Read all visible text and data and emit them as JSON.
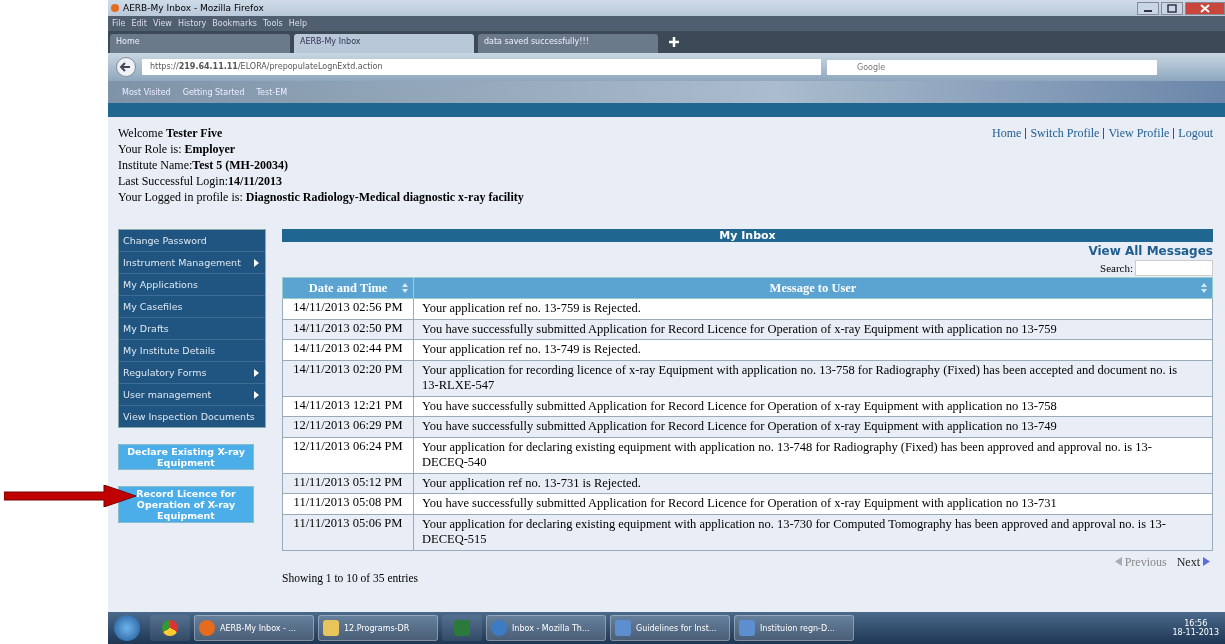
{
  "browser": {
    "title": "AERB-My Inbox - Mozilla Firefox",
    "menu": [
      "File",
      "Edit",
      "View",
      "History",
      "Bookmarks",
      "Tools",
      "Help"
    ],
    "tabs": [
      {
        "label": "Home",
        "selected": false
      },
      {
        "label": "AERB-My Inbox",
        "selected": true
      },
      {
        "label": "data saved successfully!!!",
        "selected": false
      }
    ],
    "url": "https://**219.64.11.11**/ELORA/prepopulateLognExtd.action",
    "search_placeholder": "Google",
    "bookmarks": [
      "Most Visited",
      "Getting Started",
      "Test-EM"
    ]
  },
  "header": {
    "lines": [
      "Welcome **Tester Five**",
      "Your Role is: **Employer**",
      "Institute Name:**Test 5 (MH-20034)**",
      "Last Successful Login:**14/11/2013**",
      "Your Logged in profile is: **Diagnostic Radiology-Medical diagnostic x-ray facility**"
    ],
    "links": [
      "Home",
      "Switch Profile",
      "View Profile",
      "Logout"
    ]
  },
  "sidebar": {
    "items": [
      {
        "label": "Change Password",
        "has_submenu": false
      },
      {
        "label": "Instrument Management",
        "has_submenu": true
      },
      {
        "label": "My Applications",
        "has_submenu": false
      },
      {
        "label": "My Casefiles",
        "has_submenu": false
      },
      {
        "label": "My Drafts",
        "has_submenu": false
      },
      {
        "label": "My Institute Details",
        "has_submenu": false
      },
      {
        "label": "Regulatory Forms",
        "has_submenu": true
      },
      {
        "label": "User management",
        "has_submenu": true
      },
      {
        "label": "View Inspection Documents",
        "has_submenu": false
      }
    ],
    "actions": [
      "Declare Existing X-ray Equipment",
      "Record Licence for Operation of X-ray Equipment"
    ]
  },
  "inbox": {
    "title": "My Inbox",
    "view_all": "View All Messages",
    "search_label": "Search:",
    "columns": [
      "Date and Time",
      "Message to User"
    ],
    "rows": [
      {
        "date": "14/11/2013 02:56 PM",
        "message": "Your application ref no. 13-759 is Rejected."
      },
      {
        "date": "14/11/2013 02:50 PM",
        "message": "You have successfully submitted Application for Record Licence for Operation of x-ray Equipment with application no 13-759"
      },
      {
        "date": "14/11/2013 02:44 PM",
        "message": "Your application ref no. 13-749 is Rejected."
      },
      {
        "date": "14/11/2013 02:20 PM",
        "message": "Your application for recording licence of x-ray Equipment with application no. 13-758 for Radiography (Fixed) has been accepted and document no. is 13-RLXE-547"
      },
      {
        "date": "14/11/2013 12:21 PM",
        "message": "You have successfully submitted Application for Record Licence for Operation of x-ray Equipment with application no 13-758"
      },
      {
        "date": "12/11/2013 06:29 PM",
        "message": "You have successfully submitted Application for Record Licence for Operation of x-ray Equipment with application no 13-749"
      },
      {
        "date": "12/11/2013 06:24 PM",
        "message": "Your application for declaring existing equipment with application no. 13-748 for Radiography (Fixed) has been approved and approval no. is 13-DECEQ-540"
      },
      {
        "date": "11/11/2013 05:12 PM",
        "message": "Your application ref no. 13-731 is Rejected."
      },
      {
        "date": "11/11/2013 05:08 PM",
        "message": "You have successfully submitted Application for Record Licence for Operation of x-ray Equipment with application no 13-731"
      },
      {
        "date": "11/11/2013 05:06 PM",
        "message": "Your application for declaring existing equipment with application no. 13-730 for Computed Tomography has been approved and approval no. is 13-DECEQ-515"
      }
    ],
    "showing": "Showing 1 to 10 of 35 entries",
    "previous": {
      "label": "Previous",
      "disabled": true
    },
    "next": {
      "label": "Next",
      "disabled": false
    }
  },
  "taskbar": {
    "items": [
      {
        "kind": "start"
      },
      {
        "kind": "chrome"
      },
      {
        "label": "AERB-My Inbox - ...",
        "kind": "firefox"
      },
      {
        "label": "12.Programs-DR",
        "kind": "folder"
      },
      {
        "kind": "excel"
      },
      {
        "label": "Inbox - Mozilla Th...",
        "kind": "mail"
      },
      {
        "label": "Guidelines for Inst...",
        "kind": "doc"
      },
      {
        "label": "Instituion regn-D...",
        "kind": "doc"
      }
    ],
    "time": "16:56",
    "date": "18-11-2013"
  }
}
